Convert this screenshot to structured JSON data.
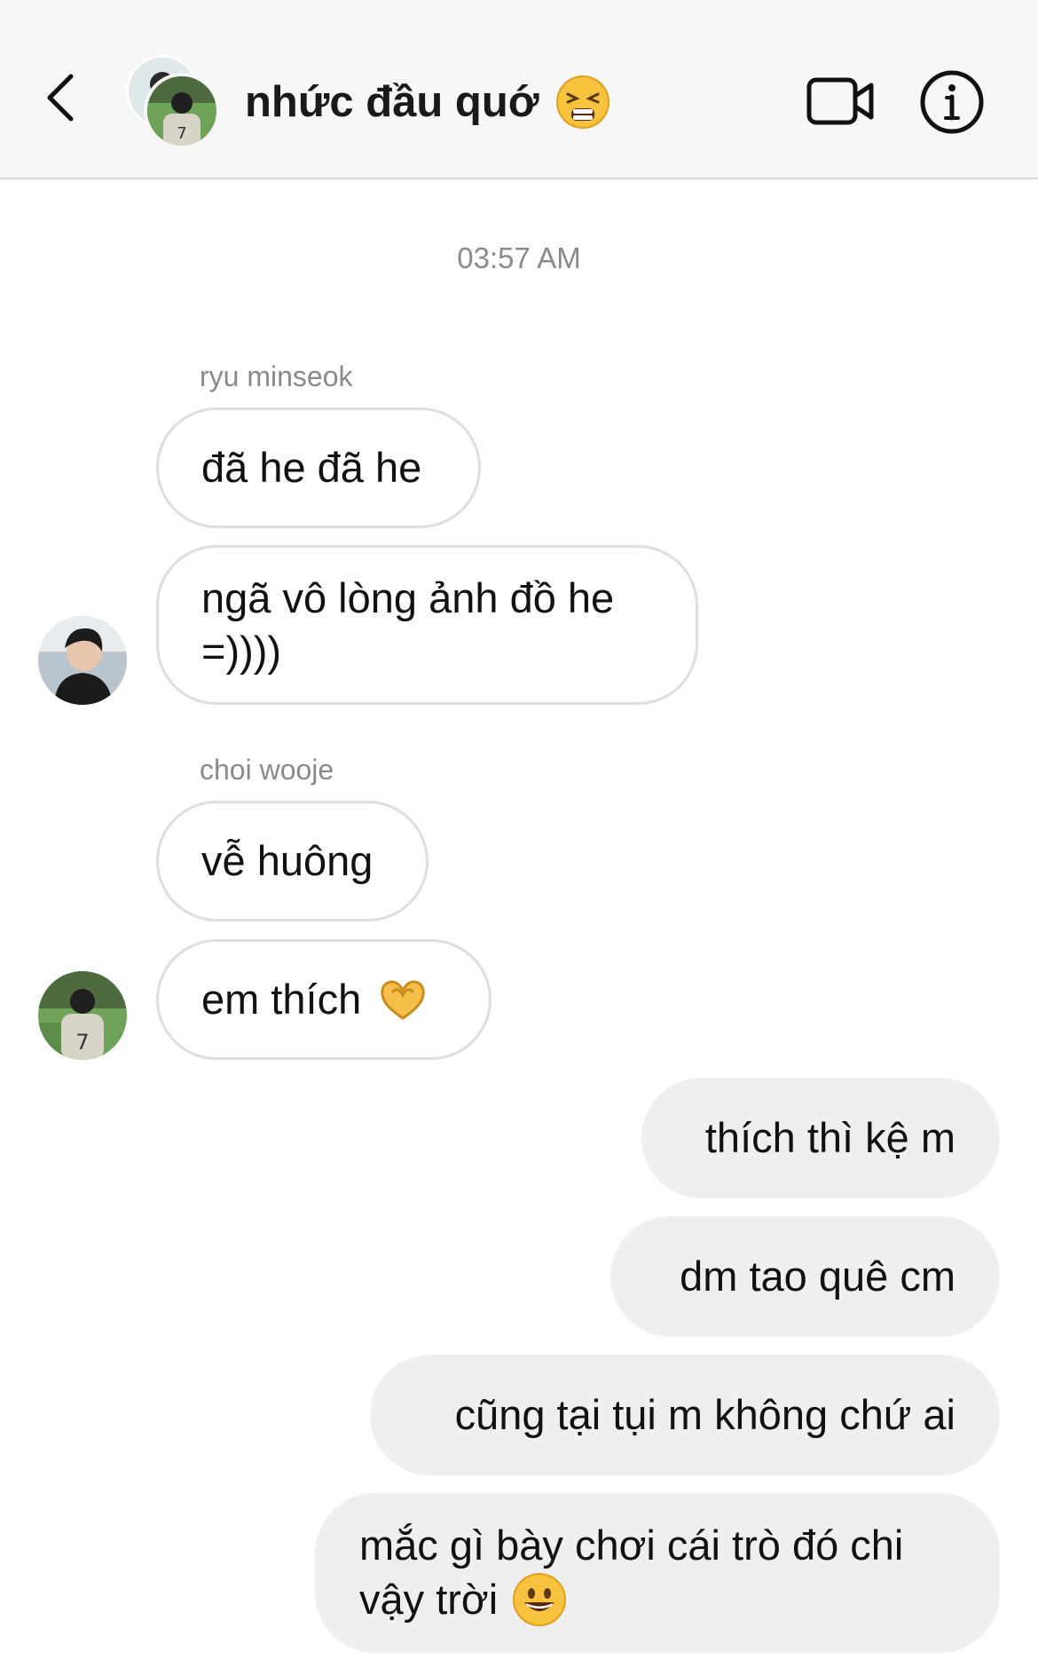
{
  "header": {
    "title": "nhức đầu quớ",
    "title_emoji": "tired-face-emoji",
    "back_icon": "chevron-left-icon",
    "video_icon": "video-camera-icon",
    "info_icon": "info-icon"
  },
  "timestamp": "03:57 AM",
  "messages": [
    {
      "sender": "ryu minseok"
    },
    {
      "text": "đã he đã he"
    },
    {
      "text_line1": "ngã vô lòng ảnh đồ he",
      "text_line2": "=))))"
    },
    {
      "sender": "choi wooje"
    },
    {
      "text": "vễ huông"
    },
    {
      "text": "em thích",
      "emoji": "heart-hands-emoji"
    },
    {
      "text": "thích thì kệ m"
    },
    {
      "text": "dm tao quê cm"
    },
    {
      "text": "cũng tại tụi m không chứ ai"
    },
    {
      "text_line1": "mắc gì bày chơi cái trò đó chi",
      "text_line2": "vậy trời",
      "emoji": "grinning-face-emoji"
    }
  ],
  "colors": {
    "header_bg": "#f7f7f7",
    "incoming_border": "#dedede",
    "outgoing_bg": "#efefef",
    "meta_text": "#8a8a8a"
  }
}
